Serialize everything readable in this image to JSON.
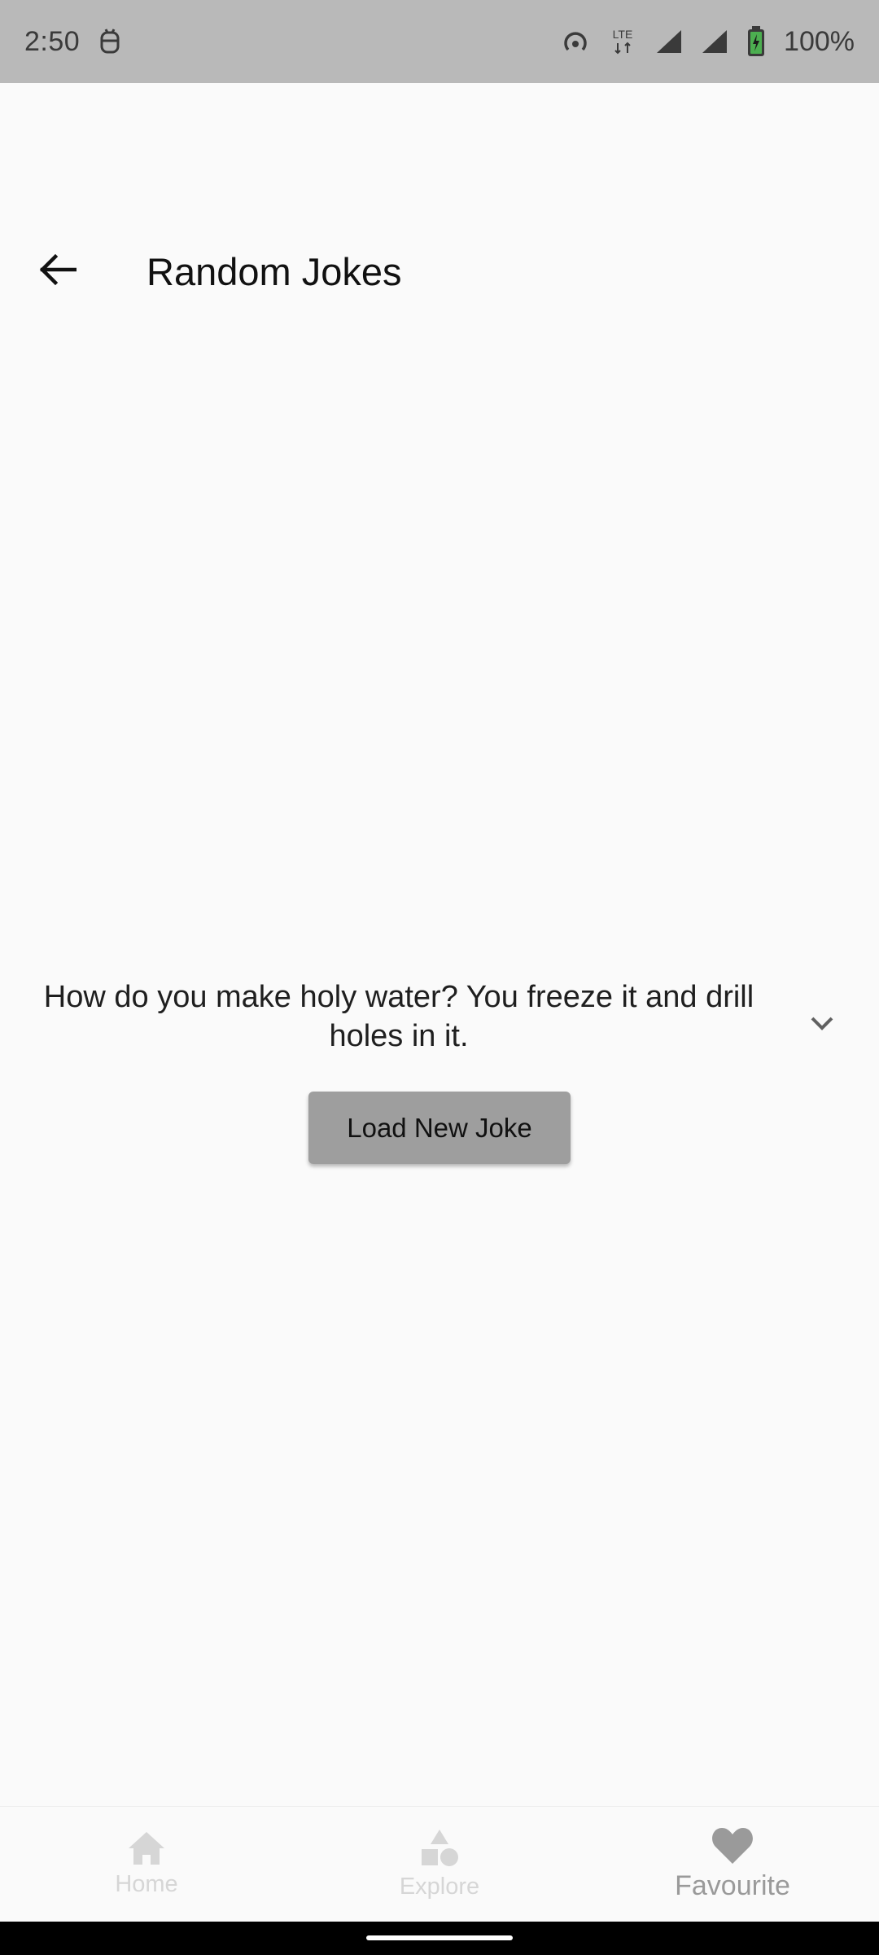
{
  "status_bar": {
    "time": "2:50",
    "battery_percent": "100%",
    "network_label": "LTE"
  },
  "app_bar": {
    "title": "Random Jokes"
  },
  "joke": {
    "text": "How do you make holy water? You freeze it and drill holes in it."
  },
  "actions": {
    "load_label": "Load New Joke"
  },
  "bottom_nav": {
    "items": [
      {
        "label": "Home",
        "icon": "home-icon",
        "active": false
      },
      {
        "label": "Explore",
        "icon": "shapes-icon",
        "active": false
      },
      {
        "label": "Favourite",
        "icon": "heart-icon",
        "active": true
      }
    ]
  },
  "colors": {
    "status_bar_bg": "#b9b9b9",
    "background": "#fafafa",
    "button_bg": "#9e9e9e",
    "nav_inactive": "#d6d6d6",
    "nav_active": "#9a9a9a"
  }
}
